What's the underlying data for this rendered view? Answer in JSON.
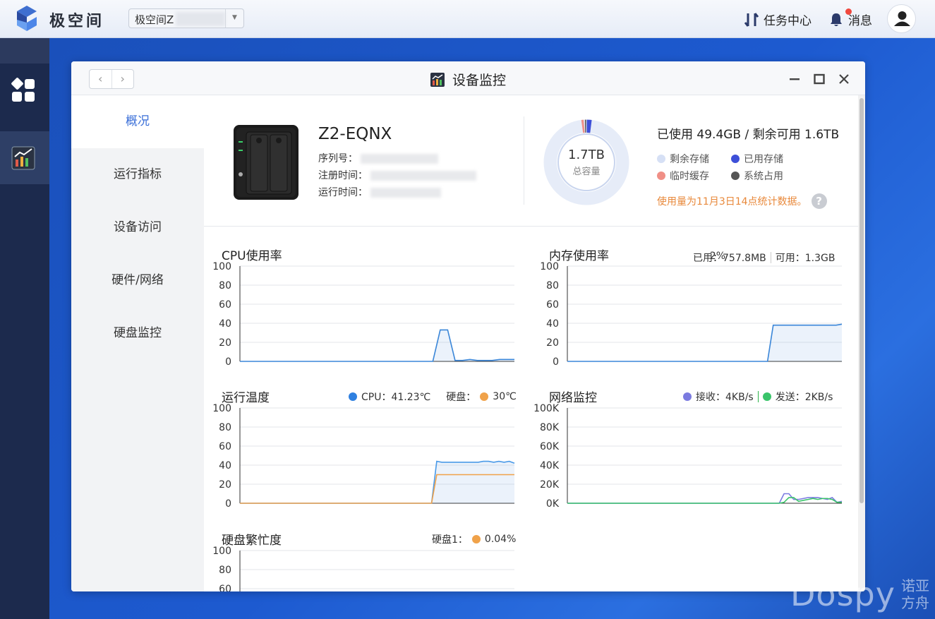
{
  "app": {
    "brand": "极空间",
    "space_select": "极空间Z",
    "task_center": "任务中心",
    "messages": "消息"
  },
  "window": {
    "title": "设备监控",
    "minimize_icon": "minimize-icon",
    "maximize_icon": "maximize-icon",
    "close_icon": "close-icon"
  },
  "sidebar": {
    "items": [
      {
        "label": "概况",
        "active": true
      },
      {
        "label": "运行指标",
        "active": false
      },
      {
        "label": "设备访问",
        "active": false
      },
      {
        "label": "硬件/网络",
        "active": false
      },
      {
        "label": "硬盘监控",
        "active": false
      }
    ]
  },
  "device": {
    "name": "Z2-EQNX",
    "serial_label": "序列号：",
    "register_label": "注册时间：",
    "uptime_label": "运行时间："
  },
  "storage": {
    "total": "1.7TB",
    "total_label": "总容量",
    "summary": "已使用 49.4GB / 剩余可用 1.6TB",
    "legend": [
      {
        "label": "剩余存储",
        "color": "#d6e0f5"
      },
      {
        "label": "已用存储",
        "color": "#3d4fd8"
      },
      {
        "label": "临时缓存",
        "color": "#f08f86"
      },
      {
        "label": "系统占用",
        "color": "#555555"
      }
    ],
    "note": "使用量为11月3日14点统计数据。",
    "help_icon": "?"
  },
  "charts": {
    "cpu": {
      "title": "CPU使用率",
      "info": "2%"
    },
    "memory": {
      "title": "内存使用率",
      "used": "已用：757.8MB",
      "avail": "可用：1.3GB"
    },
    "temp": {
      "title": "运行温度",
      "cpu": "CPU：41.23℃",
      "disk": "硬盘：",
      "disk_val": "30℃",
      "cpu_color": "#2f80e0",
      "disk_color": "#f0a24a"
    },
    "network": {
      "title": "网络监控",
      "rx": "接收：4KB/s",
      "tx": "发送：2KB/s",
      "rx_color": "#7b7be0",
      "tx_color": "#3ac46a"
    },
    "disk_busy": {
      "title": "硬盘繁忙度",
      "label": "硬盘1：",
      "value": "0.04%",
      "color": "#f0a24a"
    }
  },
  "chart_data": [
    {
      "type": "area",
      "title": "CPU使用率",
      "ylim": [
        0,
        100
      ],
      "yticks": [
        "100",
        "80",
        "60",
        "40",
        "20",
        "0"
      ],
      "series": [
        {
          "values": [
            0,
            0,
            0,
            0,
            0,
            0,
            0,
            0,
            0,
            0,
            0,
            0,
            0,
            0,
            0,
            0,
            0,
            0,
            0,
            0,
            0,
            0,
            0,
            0,
            0,
            0,
            0,
            33,
            33,
            1,
            1,
            2,
            1,
            1,
            1,
            2,
            2,
            2
          ]
        }
      ]
    },
    {
      "type": "area",
      "title": "内存使用率",
      "ylim": [
        0,
        100
      ],
      "yticks": [
        "100",
        "80",
        "60",
        "40",
        "20",
        "0"
      ],
      "series": [
        {
          "values": [
            0,
            0,
            0,
            0,
            0,
            0,
            0,
            0,
            0,
            0,
            0,
            0,
            0,
            0,
            0,
            0,
            0,
            0,
            0,
            0,
            0,
            0,
            0,
            0,
            0,
            0,
            0,
            0,
            0,
            0,
            0,
            0,
            0,
            0,
            0,
            0,
            38,
            38,
            38,
            38,
            38,
            38,
            38,
            38,
            38,
            38,
            38,
            38,
            39
          ]
        }
      ]
    },
    {
      "type": "area",
      "title": "运行温度",
      "ylim": [
        0,
        100
      ],
      "yticks": [
        "100",
        "80",
        "60",
        "40",
        "20",
        "0"
      ],
      "series": [
        {
          "name": "CPU",
          "values": [
            0,
            0,
            0,
            0,
            0,
            0,
            0,
            0,
            0,
            0,
            0,
            0,
            0,
            0,
            0,
            0,
            0,
            0,
            0,
            0,
            0,
            0,
            0,
            0,
            0,
            0,
            0,
            0,
            0,
            0,
            0,
            0,
            0,
            0,
            0,
            0,
            0,
            0,
            44,
            43,
            43,
            43,
            43,
            43,
            43,
            43,
            43,
            44,
            44,
            43,
            44,
            43,
            44,
            42
          ]
        },
        {
          "name": "硬盘",
          "values": [
            0,
            0,
            0,
            0,
            0,
            0,
            0,
            0,
            0,
            0,
            0,
            0,
            0,
            0,
            0,
            0,
            0,
            0,
            0,
            0,
            0,
            0,
            0,
            0,
            0,
            0,
            0,
            0,
            0,
            0,
            0,
            0,
            0,
            0,
            0,
            0,
            0,
            0,
            30,
            30,
            30,
            30,
            30,
            30,
            30,
            30,
            30,
            30,
            30,
            30,
            30,
            30,
            30,
            30
          ]
        }
      ]
    },
    {
      "type": "line",
      "title": "网络监控",
      "ylim": [
        0,
        100
      ],
      "yticks": [
        "100K",
        "80K",
        "60K",
        "40K",
        "20K",
        "0K"
      ],
      "series": [
        {
          "name": "接收",
          "values": [
            0,
            0,
            0,
            0,
            0,
            0,
            0,
            0,
            0,
            0,
            0,
            0,
            0,
            0,
            0,
            0,
            0,
            0,
            0,
            0,
            0,
            0,
            0,
            0,
            0,
            0,
            0,
            0,
            0,
            0,
            0,
            0,
            0,
            0,
            0,
            0,
            0,
            0,
            0,
            0,
            0,
            0,
            0,
            0,
            0,
            10,
            10,
            4,
            4,
            5,
            6,
            6,
            6,
            5,
            4,
            6,
            1,
            2
          ]
        },
        {
          "name": "发送",
          "values": [
            0,
            0,
            0,
            0,
            0,
            0,
            0,
            0,
            0,
            0,
            0,
            0,
            0,
            0,
            0,
            0,
            0,
            0,
            0,
            0,
            0,
            0,
            0,
            0,
            0,
            0,
            0,
            0,
            0,
            0,
            0,
            0,
            0,
            0,
            0,
            0,
            0,
            0,
            0,
            0,
            0,
            0,
            0,
            0,
            0,
            1,
            6,
            6,
            2,
            3,
            4,
            5,
            4,
            5,
            5,
            4,
            1,
            1
          ]
        }
      ]
    },
    {
      "type": "line",
      "title": "硬盘繁忙度",
      "ylim": [
        0,
        100
      ],
      "yticks": [
        "100",
        "80",
        "60"
      ],
      "series": [
        {
          "values": []
        }
      ]
    }
  ]
}
